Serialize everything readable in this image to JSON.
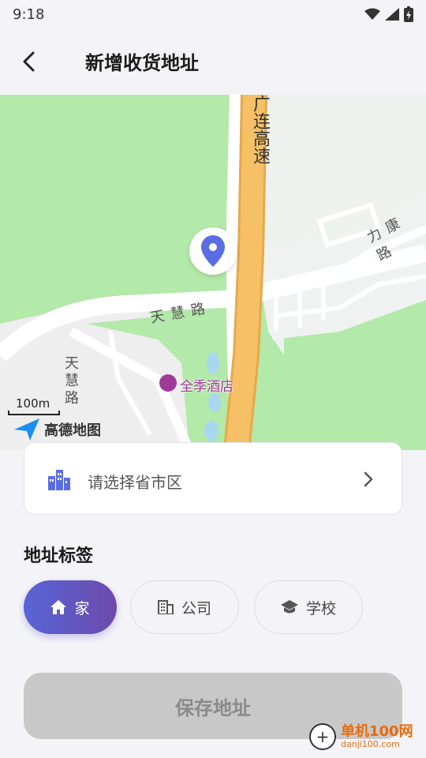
{
  "status_bar": {
    "time": "9:18"
  },
  "header": {
    "title": "新增收货地址"
  },
  "map": {
    "road_highway": "广连高速",
    "road_tianhui": "天慧路",
    "road_likang": "力康路",
    "road_tianhui_vertical": "天慧路",
    "poi_hotel": "全季酒店",
    "scale": "100m",
    "logo_text": "高德地图"
  },
  "region": {
    "placeholder": "请选择省市区"
  },
  "tags": {
    "section_label": "地址标签",
    "items": [
      {
        "label": "家",
        "icon": "home-icon",
        "selected": true
      },
      {
        "label": "公司",
        "icon": "building-icon",
        "selected": false
      },
      {
        "label": "学校",
        "icon": "school-icon",
        "selected": false
      }
    ]
  },
  "save": {
    "label": "保存地址"
  },
  "watermark": {
    "cn": "单机100网",
    "url": "danji100.com"
  },
  "colors": {
    "accent_start": "#5864d8",
    "accent_end": "#6d4aaa",
    "pin": "#5b6ee1",
    "map_green": "#b3e9a9",
    "highway": "#f5c066"
  }
}
